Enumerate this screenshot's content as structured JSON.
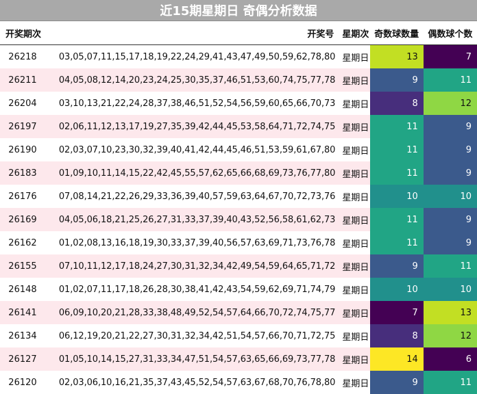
{
  "title": "近15期星期日 奇偶分析数据",
  "columns": [
    "开奖期次",
    "开奖号",
    "星期次",
    "奇数球数量",
    "偶数球个数"
  ],
  "colors": {
    "title_bg": "#a9a9a9",
    "alt_row_bg": "#fde8ec",
    "heat_scale": {
      "6": "#440154",
      "7": "#440154",
      "8": "#472e7c",
      "9": "#3b5a8c",
      "10": "#21908c",
      "11": "#21a585",
      "12": "#8fd744",
      "13": "#c2df23",
      "14": "#fde725"
    }
  },
  "rows": [
    {
      "period": "26218",
      "numbers": "03,05,07,11,15,17,18,19,22,24,29,41,43,47,49,50,59,62,78,80",
      "weekday": "星期日",
      "odd": 13,
      "even": 7
    },
    {
      "period": "26211",
      "numbers": "04,05,08,12,14,20,23,24,25,30,35,37,46,51,53,60,74,75,77,78",
      "weekday": "星期日",
      "odd": 9,
      "even": 11
    },
    {
      "period": "26204",
      "numbers": "03,10,13,21,22,24,28,37,38,46,51,52,54,56,59,60,65,66,70,73",
      "weekday": "星期日",
      "odd": 8,
      "even": 12
    },
    {
      "period": "26197",
      "numbers": "02,06,11,12,13,17,19,27,35,39,42,44,45,53,58,64,71,72,74,75",
      "weekday": "星期日",
      "odd": 11,
      "even": 9
    },
    {
      "period": "26190",
      "numbers": "02,03,07,10,23,30,32,39,40,41,42,44,45,46,51,53,59,61,67,80",
      "weekday": "星期日",
      "odd": 11,
      "even": 9
    },
    {
      "period": "26183",
      "numbers": "01,09,10,11,14,15,22,42,45,55,57,62,65,66,68,69,73,76,77,80",
      "weekday": "星期日",
      "odd": 11,
      "even": 9
    },
    {
      "period": "26176",
      "numbers": "07,08,14,21,22,26,29,33,36,39,40,57,59,63,64,67,70,72,73,76",
      "weekday": "星期日",
      "odd": 10,
      "even": 10
    },
    {
      "period": "26169",
      "numbers": "04,05,06,18,21,25,26,27,31,33,37,39,40,43,52,56,58,61,62,73",
      "weekday": "星期日",
      "odd": 11,
      "even": 9
    },
    {
      "period": "26162",
      "numbers": "01,02,08,13,16,18,19,30,33,37,39,40,56,57,63,69,71,73,76,78",
      "weekday": "星期日",
      "odd": 11,
      "even": 9
    },
    {
      "period": "26155",
      "numbers": "07,10,11,12,17,18,24,27,30,31,32,34,42,49,54,59,64,65,71,72",
      "weekday": "星期日",
      "odd": 9,
      "even": 11
    },
    {
      "period": "26148",
      "numbers": "01,02,07,11,17,18,26,28,30,38,41,42,43,54,59,62,69,71,74,79",
      "weekday": "星期日",
      "odd": 10,
      "even": 10
    },
    {
      "period": "26141",
      "numbers": "06,09,10,20,21,28,33,38,48,49,52,54,57,64,66,70,72,74,75,77",
      "weekday": "星期日",
      "odd": 7,
      "even": 13
    },
    {
      "period": "26134",
      "numbers": "06,12,19,20,21,22,27,30,31,32,34,42,51,54,57,66,70,71,72,75",
      "weekday": "星期日",
      "odd": 8,
      "even": 12
    },
    {
      "period": "26127",
      "numbers": "01,05,10,14,15,27,31,33,34,47,51,54,57,63,65,66,69,73,77,78",
      "weekday": "星期日",
      "odd": 14,
      "even": 6
    },
    {
      "period": "26120",
      "numbers": "02,03,06,10,16,21,35,37,43,45,52,54,57,63,67,68,70,76,78,80",
      "weekday": "星期日",
      "odd": 9,
      "even": 11
    }
  ]
}
